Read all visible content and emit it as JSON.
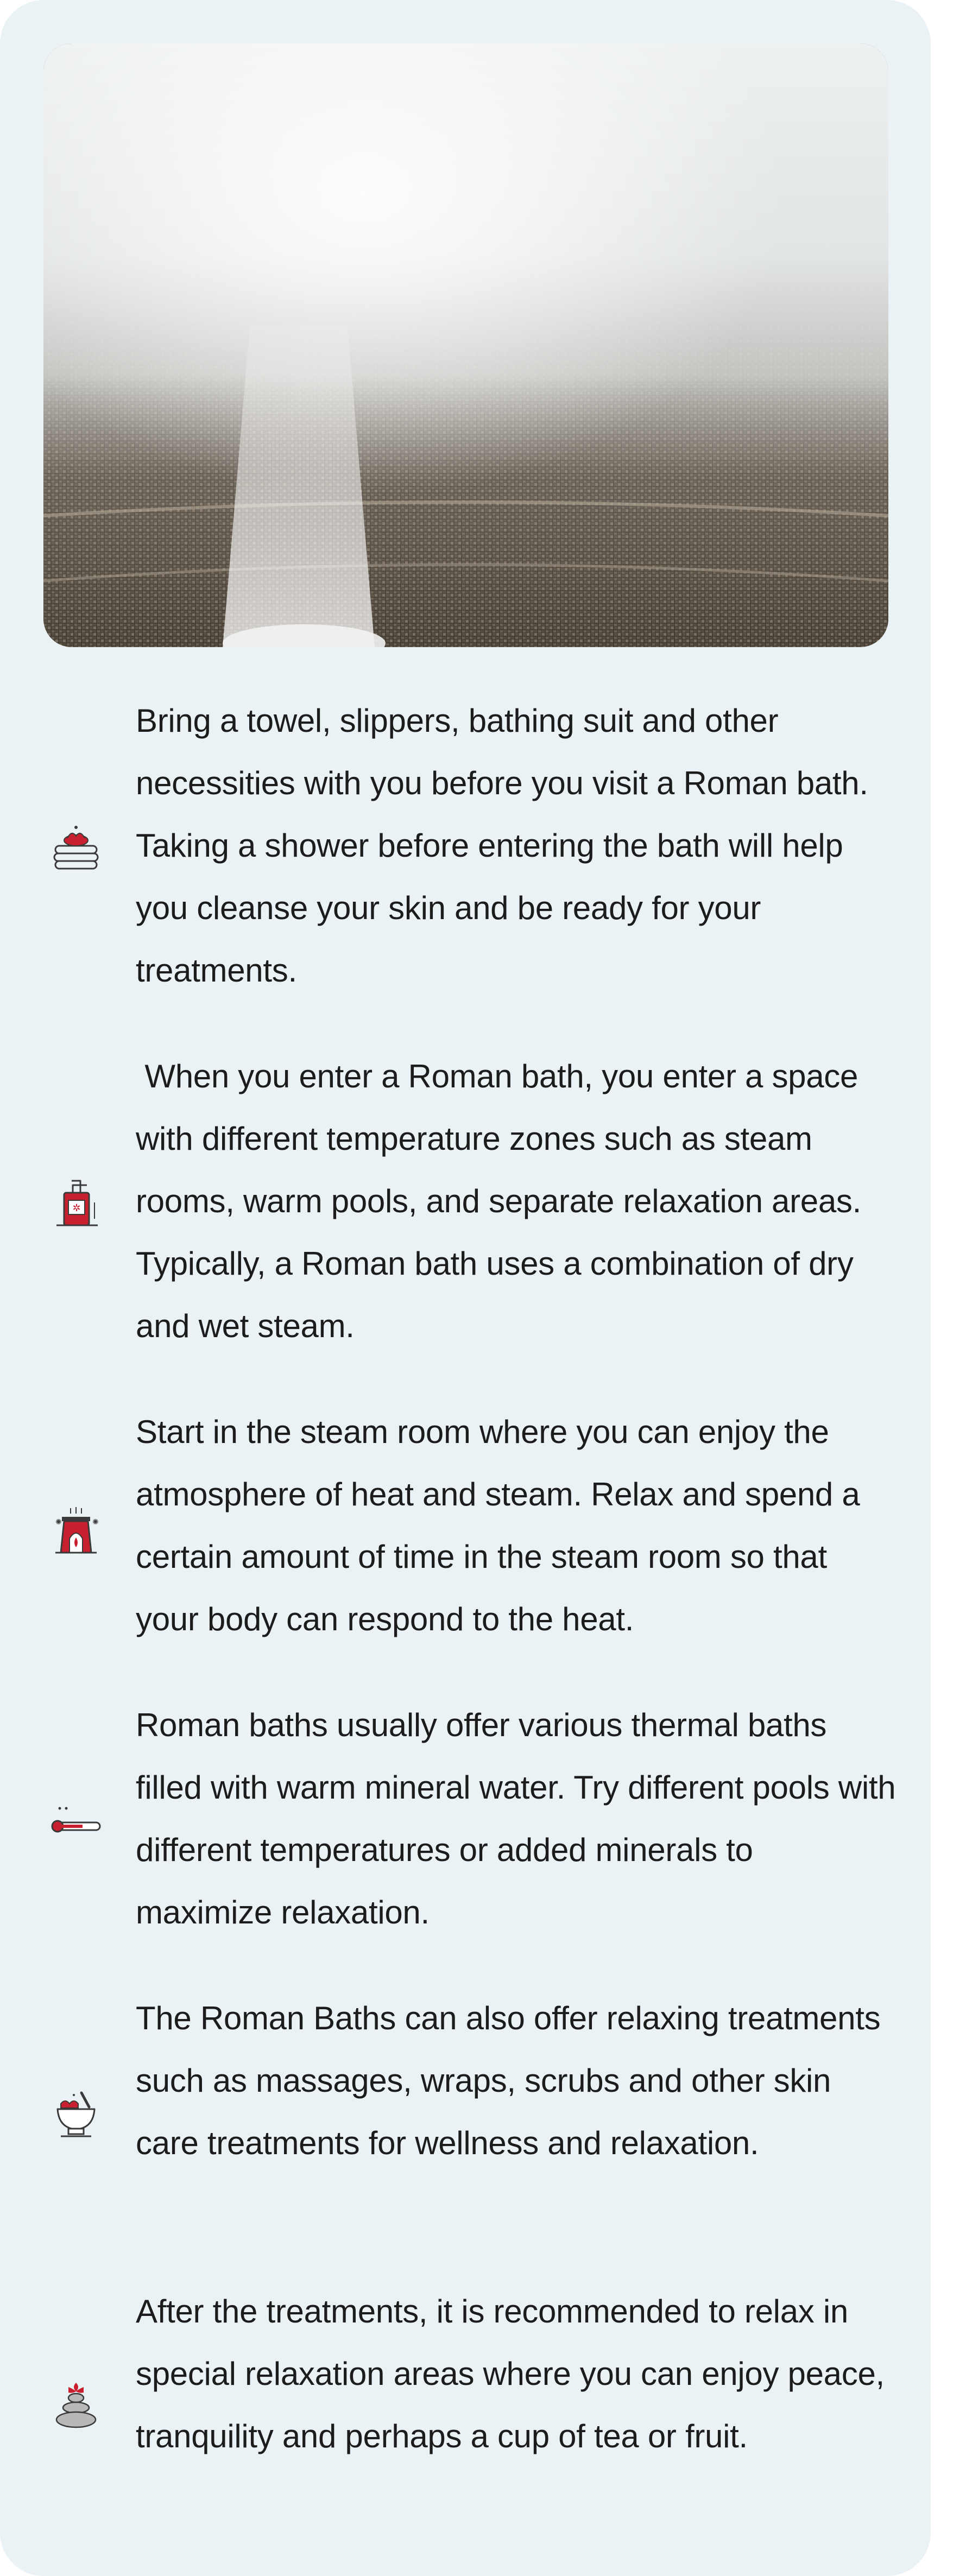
{
  "hero": {
    "icon": "steam-room-photo"
  },
  "items": [
    {
      "icon": "towels-icon",
      "text": "Bring a towel, slippers, bathing suit and other necessities with you before you visit a Roman bath. Taking a shower before entering the bath will help you cleanse your skin and be ready for your treatments."
    },
    {
      "icon": "soap-dispenser-icon",
      "text": " When you enter a Roman bath, you enter a space with different temperature zones such as steam rooms, warm pools, and separate relaxation areas. Typically, a Roman bath uses a combination of dry and wet steam."
    },
    {
      "icon": "aroma-lamp-icon",
      "text": "Start in the steam room where you can enjoy the atmosphere of heat and steam. Relax and spend a certain amount of time in the steam room so that your body can respond to the heat."
    },
    {
      "icon": "thermometer-icon",
      "text": "Roman baths usually offer various thermal baths filled with warm mineral water. Try different pools with different temperatures or added minerals to maximize relaxation."
    },
    {
      "icon": "mortar-pestle-icon",
      "text": "The Roman Baths can also offer relaxing treatments such as massages, wraps, scrubs and other skin care treatments for wellness and relaxation."
    },
    {
      "icon": "stacked-stones-icon",
      "text": "After the treatments, it is recommended to relax in special relaxation areas where you can enjoy peace, tranquility and perhaps a cup of tea or fruit."
    }
  ],
  "colors": {
    "card_background": "#ebf2f5",
    "text": "#1c1c1c",
    "icon_outline": "#3a3a3a",
    "icon_accent": "#c8202f"
  }
}
